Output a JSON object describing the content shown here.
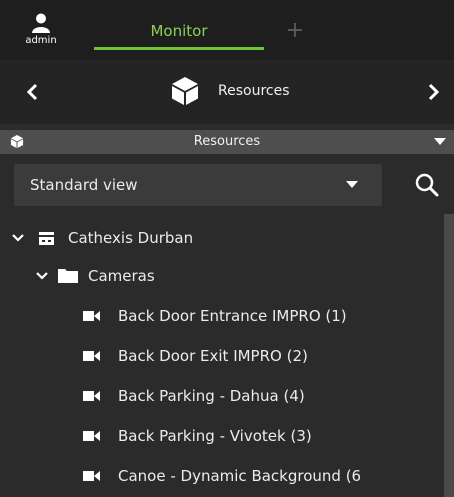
{
  "user": {
    "name": "admin",
    "icon": "user-icon"
  },
  "tabs": {
    "active_label": "Monitor",
    "add_label": "+"
  },
  "navigation": {
    "title": "Resources",
    "icon": "cube-icon"
  },
  "panel": {
    "title": "Resources"
  },
  "view": {
    "selected": "Standard view"
  },
  "tree": {
    "site": "Cathexis Durban",
    "folder": "Cameras",
    "cameras": [
      "Back Door Entrance IMPRO (1)",
      "Back Door Exit IMPRO (2)",
      "Back Parking - Dahua (4)",
      "Back Parking - Vivotek (3)",
      "Canoe - Dynamic Background (6"
    ]
  },
  "colors": {
    "accent": "#69c43c",
    "background": "#2b2b2b",
    "topbar": "#1e1e1e",
    "panel_header": "#4e4e4e"
  }
}
